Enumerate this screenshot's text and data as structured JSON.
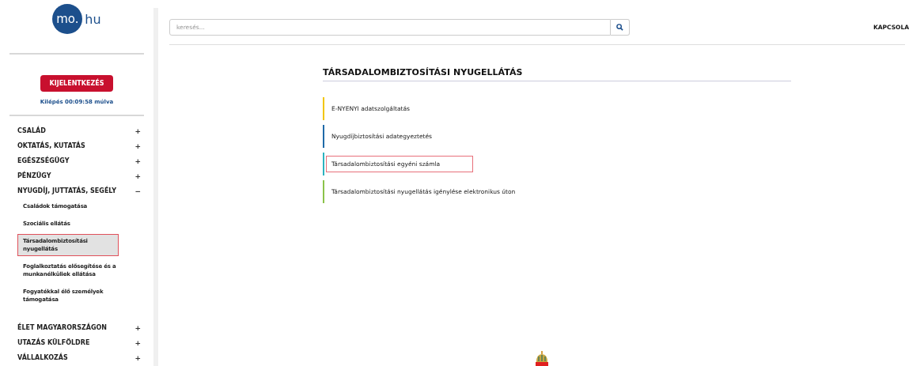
{
  "logo": {
    "circle_text": "mo.",
    "suffix": "hu"
  },
  "search": {
    "placeholder": "keresés..."
  },
  "header_link": "KAPCSOLA",
  "logout": {
    "button": "KIJELENTKEZÉS",
    "timer": "Kilépés 00:09:58 múlva"
  },
  "sidebar": {
    "items": [
      {
        "label": "CSALÁD",
        "toggle": "+"
      },
      {
        "label": "OKTATÁS, KUTATÁS",
        "toggle": "+"
      },
      {
        "label": "EGÉSZSÉGÜGY",
        "toggle": "+"
      },
      {
        "label": "PÉNZÜGY",
        "toggle": "+"
      },
      {
        "label": "NYUGDÍJ, JUTTATÁS, SEGÉLY",
        "toggle": "−",
        "children": [
          {
            "label": "Családok támogatása",
            "selected": false
          },
          {
            "label": "Szociális ellátás",
            "selected": false
          },
          {
            "label": "Társadalombiztosítási nyugellátás",
            "selected": true
          },
          {
            "label": "Foglalkoztatás elősegítése és a munkanélküliek ellátása",
            "selected": false
          },
          {
            "label": "Fogyatékkal élő személyek támogatása",
            "selected": false
          }
        ]
      },
      {
        "label": "ÉLET MAGYARORSZÁGON",
        "toggle": "+"
      },
      {
        "label": "UTAZÁS KÜLFÖLDRE",
        "toggle": "+"
      },
      {
        "label": "VÁLLALKOZÁS",
        "toggle": "+"
      }
    ]
  },
  "page": {
    "title": "TÁRSADALOMBIZTOSÍTÁSI NYUGELLÁTÁS",
    "links": [
      {
        "label": "E-NYENYI adatszolgáltatás",
        "color": "#f2c500",
        "selected": false
      },
      {
        "label": "Nyugdíjbiztosítási adategyeztetés",
        "color": "#1f6aa8",
        "selected": false
      },
      {
        "label": "Társadalombiztosítási egyéni számla",
        "color": "#2bb3c0",
        "selected": true
      },
      {
        "label": "Társadalombiztosítási nyugellátás igénylése elektronikus úton",
        "color": "#8bc34a",
        "selected": false
      }
    ]
  }
}
